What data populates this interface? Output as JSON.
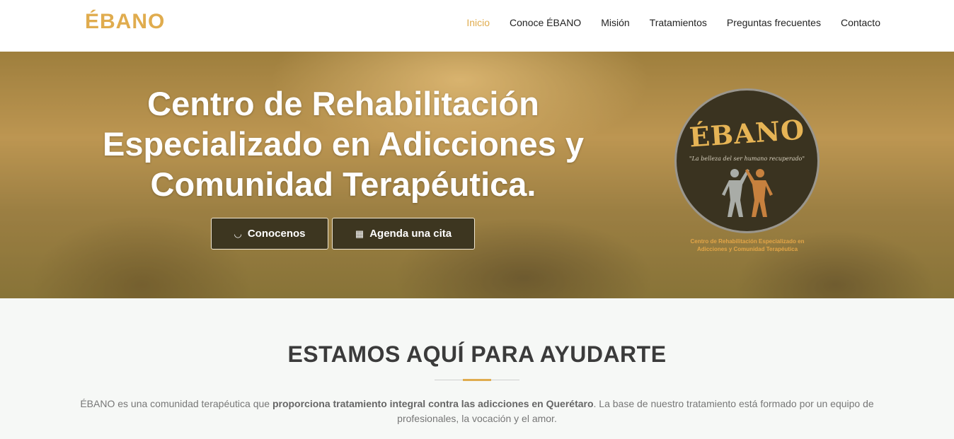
{
  "nav": {
    "brand": "ÉBANO",
    "items": [
      {
        "label": "Inicio",
        "active": true
      },
      {
        "label": "Conoce ÉBANO",
        "active": false
      },
      {
        "label": "Misión",
        "active": false
      },
      {
        "label": "Tratamientos",
        "active": false
      },
      {
        "label": "Preguntas frecuentes",
        "active": false
      },
      {
        "label": "Contacto",
        "active": false
      }
    ]
  },
  "hero": {
    "title": "Centro de Rehabilitación Especializado en Adicciones y Comunidad Terapéutica.",
    "buttons": {
      "about": {
        "label": "Conocenos",
        "icon": "smile-icon"
      },
      "schedule": {
        "label": "Agenda una cita",
        "icon": "calendar-icon"
      }
    },
    "logo": {
      "word": "ÉBANO",
      "tagline": "\"La belleza del ser humano recuperado\"",
      "subtitle": "Centro de Rehabilitación Especializado en Adicciones y Comunidad Terapéutica"
    }
  },
  "intro": {
    "heading": "ESTAMOS AQUÍ PARA AYUDARTE",
    "text_before": "ÉBANO es una comunidad terapéutica que ",
    "text_bold": "proporciona tratamiento integral contra las adicciones en Querétaro",
    "text_after": ". La base de nuestro tratamiento está formado por un equipo de profesionales, la vocación y el amor."
  },
  "colors": {
    "accent": "#e0ac4e",
    "button_bg": "#3d3620",
    "heading": "#3b3b3b"
  }
}
